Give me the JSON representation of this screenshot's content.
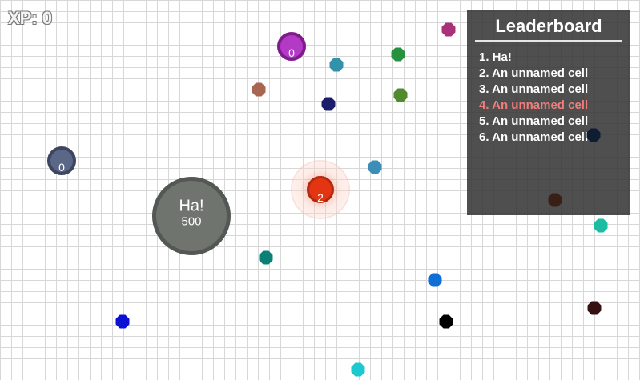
{
  "hud": {
    "xp_text": "XP: 0"
  },
  "leaderboard": {
    "title": "Leaderboard",
    "entries": [
      {
        "rank": 1,
        "text": "1. Ha!"
      },
      {
        "rank": 2,
        "text": "2. An unnamed cell"
      },
      {
        "rank": 3,
        "text": "3. An unnamed cell"
      },
      {
        "rank": 4,
        "text": "4. An unnamed cell",
        "highlighted": true,
        "highlight_color": "#f17c7c"
      },
      {
        "rank": 5,
        "text": "5. An unnamed cell"
      },
      {
        "rank": 6,
        "text": "6. An unnamed cell"
      }
    ]
  },
  "cells": {
    "big": {
      "name": "Ha!",
      "mass": "500",
      "color": "#6f746f",
      "border": "#545854"
    },
    "red": {
      "mass": "2",
      "color": "#e33512",
      "border": "#b12a0f"
    },
    "purple": {
      "mass": "0",
      "color": "#b23ac5",
      "border": "#7f1b8c"
    },
    "slate": {
      "mass": "0",
      "color": "#5b6787",
      "border": "#3d465e"
    }
  },
  "pellet_colors": [
    "#a8317a",
    "#26923f",
    "#3292aa",
    "#a86651",
    "#1a1d69",
    "#528a2f",
    "#0f1d33",
    "#3c8eb8",
    "#3a1f16",
    "#1abca2",
    "#0b8077",
    "#0e6fd6",
    "#0c0fd4",
    "#000000",
    "#361012",
    "#1bc9cf"
  ]
}
